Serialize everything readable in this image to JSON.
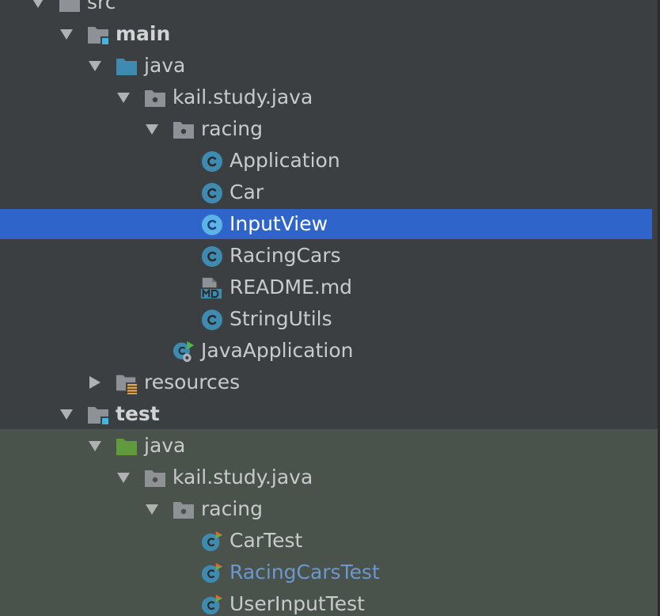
{
  "colors": {
    "background": "#3c3f41",
    "test_background": "#49524b",
    "selection": "#2f65ca",
    "text": "#c8cacc",
    "modified_text": "#6c98cf",
    "folder_gray": "#8e9297",
    "source_folder_blue": "#3d8bb0",
    "test_folder_green": "#5f9a3b",
    "class_icon_blue": "#3d8bb0",
    "test_marker": "#e8632b"
  },
  "project_tree": {
    "items": [
      {
        "id": "src",
        "label": "src",
        "icon": "folder-icon",
        "expanded": true
      },
      {
        "id": "main",
        "label": "main",
        "icon": "module-folder-icon",
        "expanded": true,
        "bold": true
      },
      {
        "id": "main-java",
        "label": "java",
        "icon": "source-folder-icon",
        "expanded": true
      },
      {
        "id": "main-package",
        "label": "kail.study.java",
        "icon": "package-icon",
        "expanded": true
      },
      {
        "id": "main-racing",
        "label": "racing",
        "icon": "package-icon",
        "expanded": true
      },
      {
        "id": "application",
        "label": "Application",
        "icon": "class-icon"
      },
      {
        "id": "car",
        "label": "Car",
        "icon": "class-icon"
      },
      {
        "id": "inputview",
        "label": "InputView",
        "icon": "class-icon",
        "selected": true
      },
      {
        "id": "racingcars",
        "label": "RacingCars",
        "icon": "class-icon"
      },
      {
        "id": "readme",
        "label": "README.md",
        "icon": "markdown-file-icon"
      },
      {
        "id": "stringutils",
        "label": "StringUtils",
        "icon": "class-icon"
      },
      {
        "id": "javaapplication",
        "label": "JavaApplication",
        "icon": "spring-boot-application-icon"
      },
      {
        "id": "resources",
        "label": "resources",
        "icon": "resources-folder-icon",
        "expanded": false
      },
      {
        "id": "test",
        "label": "test",
        "icon": "module-folder-icon",
        "expanded": true,
        "bold": true
      },
      {
        "id": "test-java",
        "label": "java",
        "icon": "test-source-folder-icon",
        "expanded": true
      },
      {
        "id": "test-package",
        "label": "kail.study.java",
        "icon": "package-icon",
        "expanded": true
      },
      {
        "id": "test-racing",
        "label": "racing",
        "icon": "package-icon",
        "expanded": true
      },
      {
        "id": "cartest",
        "label": "CarTest",
        "icon": "test-class-icon"
      },
      {
        "id": "racingcarstest",
        "label": "RacingCarsTest",
        "icon": "test-class-icon",
        "modified": true
      },
      {
        "id": "userinputtest",
        "label": "UserInputTest",
        "icon": "test-class-icon"
      }
    ]
  }
}
